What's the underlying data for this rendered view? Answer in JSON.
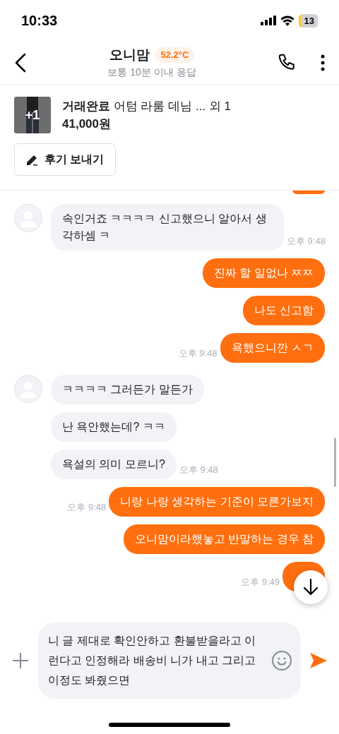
{
  "status_bar": {
    "time": "10:33",
    "battery": "13"
  },
  "header": {
    "name": "오니맘",
    "temperature": "52.2°C",
    "response": "보통 10분 이내 응답"
  },
  "product": {
    "thumb_badge": "+1",
    "status": "거래완료",
    "title": "어텀 라룸 데님 ... 외 1",
    "price": "41,000원",
    "review_button": "후기 보내기"
  },
  "messages": [
    {
      "kind": "received",
      "avatar": true,
      "text": "속인거죠 ㅋㅋㅋㅋ 신고했으니 알아서 생각하셈 ㅋ",
      "time": "오후 9:48"
    },
    {
      "kind": "sent",
      "text": "진짜 할 일없나 ㅉㅉ"
    },
    {
      "kind": "sent",
      "text": "나도 신고함"
    },
    {
      "kind": "sent",
      "text": "욕했으니깐 ㅅㄱ",
      "time": "오후 9:48"
    },
    {
      "kind": "received",
      "avatar": true,
      "text": "ㅋㅋㅋㅋ 그러든가 말든가"
    },
    {
      "kind": "received",
      "avatar": false,
      "text": "난 욕안했는데? ㅋㅋ"
    },
    {
      "kind": "received",
      "avatar": false,
      "text": "욕설의 의미 모르니?",
      "time": "오후 9:48"
    },
    {
      "kind": "sent",
      "text": "니랑 나랑 생각하는 기준이 모른가보지",
      "time": "오후 9:48"
    },
    {
      "kind": "sent",
      "text": "오니맘이라했놓고 반말하는 경우 참"
    },
    {
      "kind": "sent",
      "time": "오후 9:49"
    }
  ],
  "composer": {
    "value": "니 글 제대로 확인안하고 환불받을라고 이런다고 인정해라 배송비 니가 내고 그리고 이정도 봐줬으면"
  }
}
